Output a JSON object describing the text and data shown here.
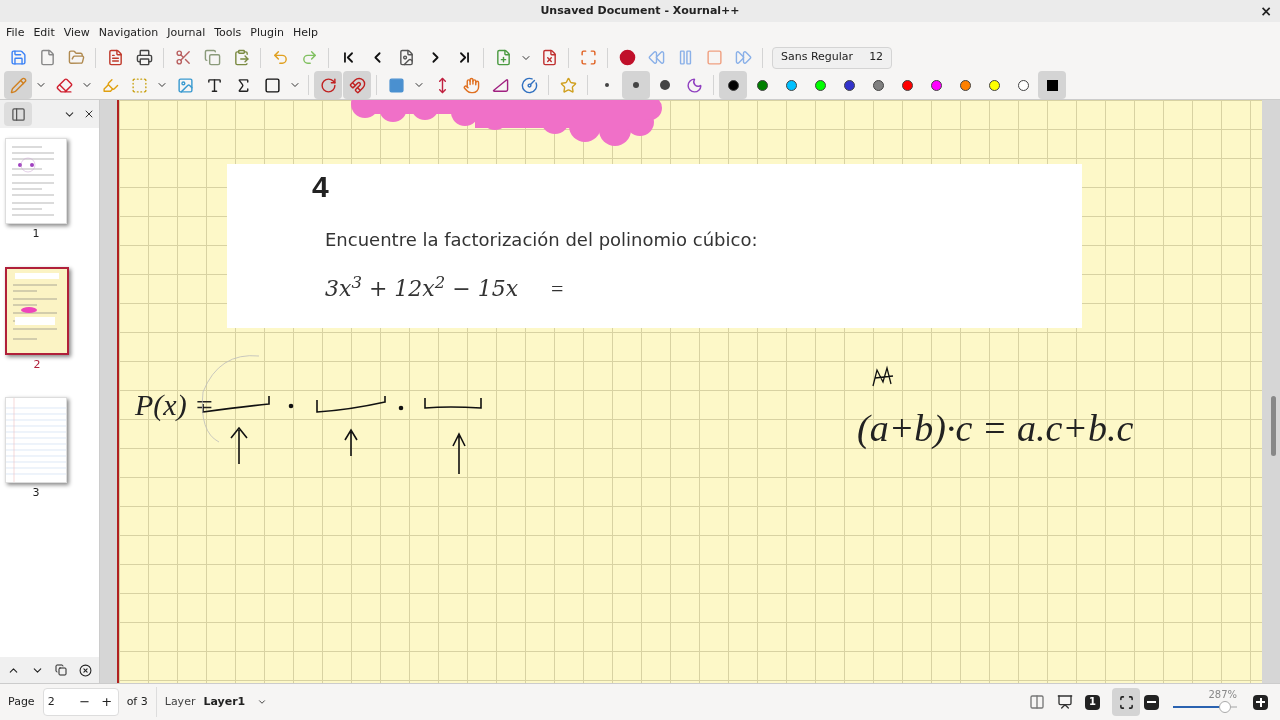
{
  "window": {
    "title": "Unsaved Document - Xournal++",
    "close": "×"
  },
  "menu": [
    "File",
    "Edit",
    "View",
    "Navigation",
    "Journal",
    "Tools",
    "Plugin",
    "Help"
  ],
  "toolbar_main": [
    {
      "kind": "save"
    },
    {
      "kind": "new"
    },
    {
      "kind": "open"
    },
    {
      "kind": "sep"
    },
    {
      "kind": "pdf"
    },
    {
      "kind": "print"
    },
    {
      "kind": "sep"
    },
    {
      "kind": "cut"
    },
    {
      "kind": "copy"
    },
    {
      "kind": "paste"
    },
    {
      "kind": "sep"
    },
    {
      "kind": "undo"
    },
    {
      "kind": "redo"
    },
    {
      "kind": "sep"
    },
    {
      "kind": "first"
    },
    {
      "kind": "prev"
    },
    {
      "kind": "goto"
    },
    {
      "kind": "next"
    },
    {
      "kind": "last"
    },
    {
      "kind": "sep"
    },
    {
      "kind": "addpage"
    },
    {
      "kind": "dropdown"
    },
    {
      "kind": "delpage"
    },
    {
      "kind": "sep"
    },
    {
      "kind": "fullscreen"
    },
    {
      "kind": "sep"
    },
    {
      "kind": "record"
    },
    {
      "kind": "rewind"
    },
    {
      "kind": "pause"
    },
    {
      "kind": "stop"
    },
    {
      "kind": "forward"
    },
    {
      "kind": "sep"
    }
  ],
  "font_button": {
    "font": "Sans Regular",
    "size": "12"
  },
  "toolbar_tools": [
    {
      "kind": "pen",
      "selected": true
    },
    {
      "kind": "dropdown",
      "selected": false
    },
    {
      "kind": "eraser",
      "selected": false
    },
    {
      "kind": "dropdown",
      "selected": false
    },
    {
      "kind": "highlighter",
      "selected": false
    },
    {
      "kind": "select",
      "selected": false
    },
    {
      "kind": "dropdown",
      "selected": false
    },
    {
      "kind": "image",
      "selected": false
    },
    {
      "kind": "text",
      "selected": false
    },
    {
      "kind": "latex",
      "selected": false
    },
    {
      "kind": "rectangle",
      "selected": false
    },
    {
      "kind": "dropdown",
      "selected": false
    },
    {
      "kind": "sep"
    },
    {
      "kind": "rotation",
      "selected": true
    },
    {
      "kind": "magnet",
      "selected": true
    },
    {
      "kind": "sep"
    },
    {
      "kind": "shape",
      "selected": false
    },
    {
      "kind": "dropdown",
      "selected": false
    },
    {
      "kind": "vspace",
      "selected": false
    },
    {
      "kind": "hand",
      "selected": false
    },
    {
      "kind": "ruler",
      "selected": false
    },
    {
      "kind": "compass",
      "selected": false
    },
    {
      "kind": "sep"
    },
    {
      "kind": "star",
      "selected": false
    },
    {
      "kind": "sep"
    },
    {
      "kind": "dot-fine",
      "selected": false
    },
    {
      "kind": "dot-medium",
      "selected": true
    },
    {
      "kind": "dot-thick",
      "selected": false
    },
    {
      "kind": "fill",
      "selected": false
    }
  ],
  "pen_colors": [
    {
      "color": "#000000",
      "selected": true
    },
    {
      "color": "#008000",
      "selected": false
    },
    {
      "color": "#00c0ff",
      "selected": false
    },
    {
      "color": "#00ff00",
      "selected": false
    },
    {
      "color": "#3333cc",
      "selected": false
    },
    {
      "color": "#808080",
      "selected": false
    },
    {
      "color": "#ff0000",
      "selected": false
    },
    {
      "color": "#ff00ff",
      "selected": false
    },
    {
      "color": "#ff8000",
      "selected": false
    },
    {
      "color": "#ffff00",
      "selected": false
    },
    {
      "color": "#ffffff",
      "selected": false
    }
  ],
  "custom_color": {
    "color": "#000000",
    "selected": true
  },
  "sidebar": {
    "pages": [
      {
        "label": "1",
        "selected": false,
        "kind": "notes"
      },
      {
        "label": "2",
        "selected": true,
        "kind": "grid"
      },
      {
        "label": "3",
        "selected": false,
        "kind": "lined"
      }
    ]
  },
  "page": {
    "exercise_number": "4",
    "prompt": "Encuentre la factorización del polinomio cúbico:",
    "expression": "3x$^{3}$ + 12x$^{2}$ − 15x",
    "equals": "=",
    "notes": [
      {
        "text": "P(x) ="
      },
      {
        "text": "(a+b)·c = a.c+b.c"
      }
    ]
  },
  "status_bar": {
    "page_label": "Page",
    "page_value": "2",
    "minus": "−",
    "plus": "+",
    "page_count": "of 3",
    "layer_label": "Layer",
    "layer_value": "Layer1",
    "actual_size": "1",
    "fit_selected": true,
    "zoom_reading": "287%",
    "zoom": {
      "level": 0.82
    }
  }
}
